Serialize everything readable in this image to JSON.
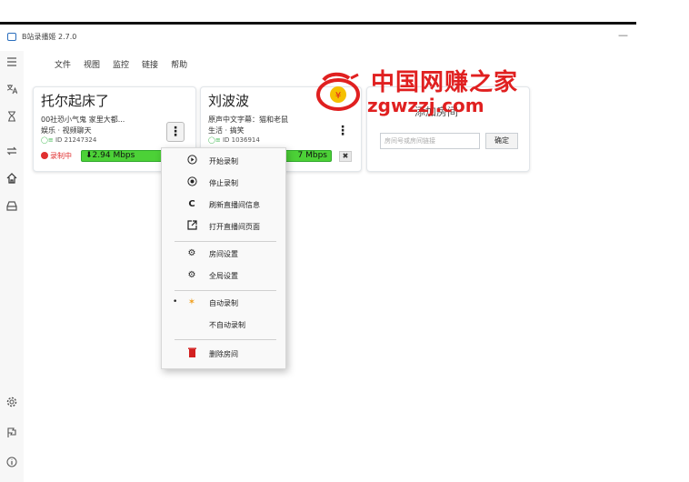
{
  "app": {
    "title": "B站录播姬 2.7.0",
    "minimize": "—"
  },
  "menu": [
    "文件",
    "视图",
    "监控",
    "链接",
    "帮助"
  ],
  "sidebar": {
    "icons": [
      "menu-icon",
      "translate-icon",
      "hourglass-icon",
      "swap-icon",
      "home-icon",
      "drive-icon",
      "settings-icon",
      "flag-icon",
      "info-icon"
    ]
  },
  "cards": [
    {
      "name": "托尔起床了",
      "title": "00社恐小气鬼 家里大都...",
      "category": "娱乐 · 视频聊天",
      "room_prefix": "ID",
      "room_id": "21247324",
      "status": "录制中",
      "speed": "2.94 Mbps"
    },
    {
      "name": "刘波波",
      "title": "原声中文字幕：猫和老鼠",
      "category": "生活 · 搞笑",
      "room_prefix": "ID",
      "room_id": "1036914",
      "speed_partial": "7 Mbps",
      "close": "✖"
    }
  ],
  "add_room": {
    "title": "添加房间",
    "placeholder": "房间号或房间链接",
    "confirm": "确定"
  },
  "context_menu": {
    "items": [
      {
        "label": "开始录制",
        "icon": "play-circle-icon"
      },
      {
        "label": "停止录制",
        "icon": "stop-circle-icon"
      },
      {
        "label": "刷新直播间信息",
        "icon": "refresh-icon"
      },
      {
        "label": "打开直播间页面",
        "icon": "open-external-icon"
      },
      {
        "label": "房间设置",
        "icon": "gear-icon"
      },
      {
        "label": "全局设置",
        "icon": "gear-icon"
      },
      {
        "label": "自动录制",
        "icon": "magic-icon",
        "selected": true
      },
      {
        "label": "不自动录制",
        "icon": ""
      },
      {
        "label": "删除房间",
        "icon": "trash-icon"
      }
    ]
  },
  "watermark": {
    "text": "中国网赚之家",
    "url": "zgwzzj.com"
  },
  "colors": {
    "accent": "#2a6ebd",
    "recording": "#e03030",
    "speed": "#4cd137",
    "watermark": "#e02020"
  }
}
